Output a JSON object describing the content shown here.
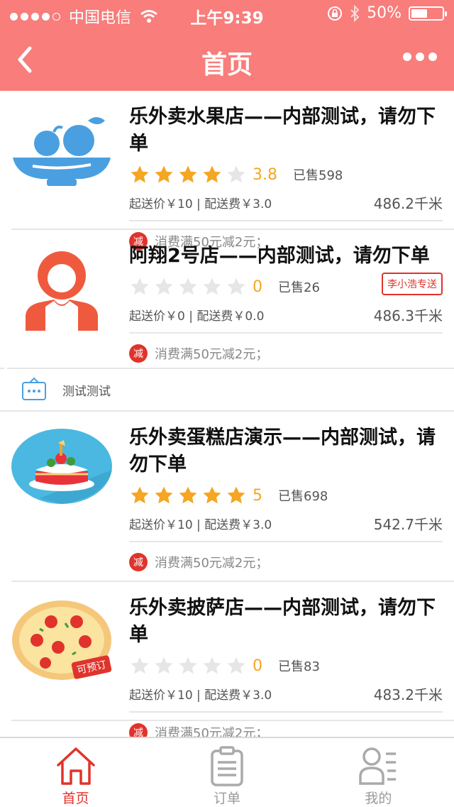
{
  "status_bar": {
    "carrier": "中国电信",
    "time": "上午9:39",
    "battery": "50%"
  },
  "nav": {
    "title": "首页"
  },
  "colors": {
    "accent": "#f87d7b",
    "promo_red": "#e0332b",
    "star_gold": "#f5a623",
    "star_gray": "#e6e6e6"
  },
  "stores": [
    {
      "name": "乐外卖水果店——内部测试，请勿下单",
      "rating": 3.8,
      "score_text": "3.8",
      "stars_filled": 4,
      "sold": "已售598",
      "fees": "起送价￥10 | 配送费￥3.0",
      "distance": "486.2千米",
      "promo_badge": "减",
      "promo": "消费满50元减2元；",
      "icon": "fruit-bowl-icon"
    },
    {
      "name": "阿翔2号店——内部测试，请勿下单",
      "rating": 0,
      "score_text": "0",
      "stars_filled": 0,
      "sold": "已售26",
      "fees": "起送价￥0 | 配送费￥0.0",
      "distance": "486.3千米",
      "delivery_tag": "李小浩专送",
      "promo_badge": "减",
      "promo": "消费满50元减2元；",
      "icon": "shopkeeper-avatar-icon"
    },
    {
      "name": "乐外卖蛋糕店演示——内部测试，请勿下单",
      "rating": 5,
      "score_text": "5",
      "stars_filled": 5,
      "sold": "已售698",
      "fees": "起送价￥10 | 配送费￥3.0",
      "distance": "542.7千米",
      "promo_badge": "减",
      "promo": "消费满50元减2元；",
      "icon": "cake-icon"
    },
    {
      "name": "乐外卖披萨店——内部测试，请勿下单",
      "rating": 0,
      "score_text": "0",
      "stars_filled": 0,
      "sold": "已售83",
      "fees": "起送价￥10 | 配送费￥3.0",
      "distance": "483.2千米",
      "preorder_tag": "可预订",
      "promo_badge": "减",
      "promo": "消费满50元减2元；",
      "icon": "pizza-icon"
    }
  ],
  "notice": {
    "text": "测试测试"
  },
  "tabs": [
    {
      "label": "首页",
      "active": true,
      "icon": "home-icon"
    },
    {
      "label": "订单",
      "active": false,
      "icon": "clipboard-icon"
    },
    {
      "label": "我的",
      "active": false,
      "icon": "profile-icon"
    }
  ]
}
